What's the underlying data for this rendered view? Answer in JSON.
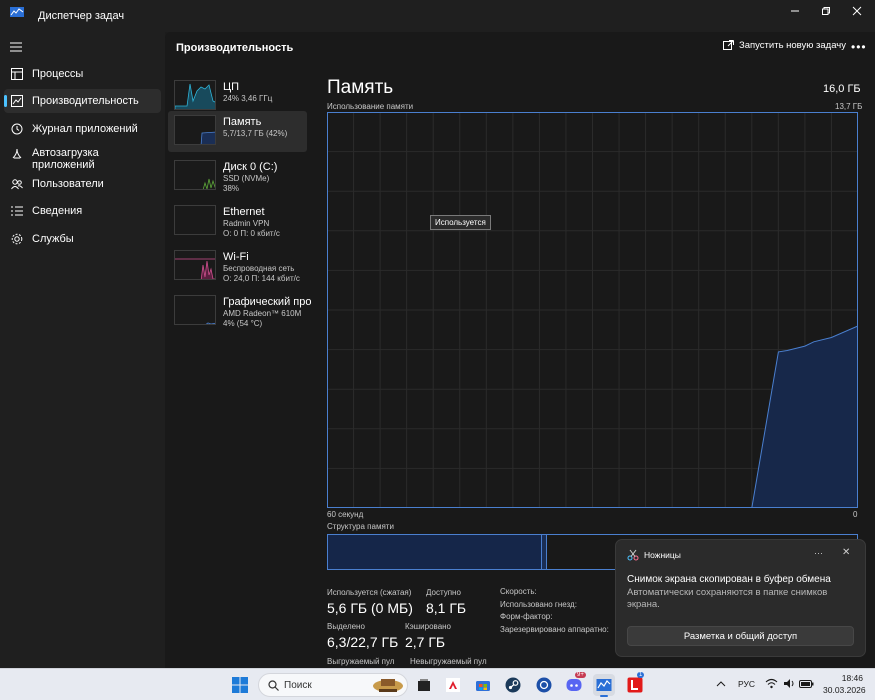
{
  "window": {
    "title": "Диспетчер задач"
  },
  "nav": {
    "items": [
      {
        "label": "Процессы",
        "icon": "grid-icon"
      },
      {
        "label": "Производительность",
        "icon": "performance-icon",
        "active": true
      },
      {
        "label": "Журнал приложений",
        "icon": "history-icon"
      },
      {
        "label": "Автозагрузка приложений",
        "icon": "startup-icon"
      },
      {
        "label": "Пользователи",
        "icon": "users-icon"
      },
      {
        "label": "Сведения",
        "icon": "details-icon"
      },
      {
        "label": "Службы",
        "icon": "services-icon"
      }
    ]
  },
  "header": {
    "title": "Производительность",
    "run_task": "Запустить новую задачу"
  },
  "devices": [
    {
      "name": "ЦП",
      "line1": "24% 3,46 ГГц",
      "line2": "",
      "color": "#2fb4d8"
    },
    {
      "name": "Память",
      "line1": "5,7/13,7 ГБ (42%)",
      "line2": "",
      "color": "#4a7fcf",
      "active": true
    },
    {
      "name": "Диск 0 (C:)",
      "line1": "SSD (NVMe)",
      "line2": "38%",
      "color": "#5ea83a"
    },
    {
      "name": "Ethernet",
      "line1": "Radmin VPN",
      "line2": "О: 0 П: 0 кбит/с",
      "color": "#a54b8f"
    },
    {
      "name": "Wi-Fi",
      "line1": "Беспроводная сеть",
      "line2": "О: 24,0 П: 144 кбит/с",
      "color": "#d0508f"
    },
    {
      "name": "Графический про",
      "line1": "AMD Radeon™ 610M",
      "line2": "4% (54 °C)",
      "color": "#4a7fcf"
    }
  ],
  "memory": {
    "title": "Память",
    "total": "16,0 ГБ",
    "usage_label": "Использование памяти",
    "usage_max": "13,7 ГБ",
    "x_left": "60 секунд",
    "x_right": "0",
    "tooltip": "Используется",
    "structure_label": "Структура памяти",
    "stats": [
      {
        "label": "Используется (сжатая)",
        "value": "5,6 ГБ (0 МБ)"
      },
      {
        "label": "Доступно",
        "value": "8,1 ГБ"
      },
      {
        "label": "Выделено",
        "value": "6,3/22,7 ГБ"
      },
      {
        "label": "Кэшировано",
        "value": "2,7 ГБ"
      },
      {
        "label": "Выгружаемый пул",
        "value": ""
      },
      {
        "label": "Невыгружаемый пул",
        "value": ""
      }
    ],
    "props": [
      {
        "label": "Скорость:"
      },
      {
        "label": "Использовано гнезд:"
      },
      {
        "label": "Форм-фактор:"
      },
      {
        "label": "Зарезервировано аппаратно:"
      }
    ]
  },
  "chart_data": {
    "type": "area",
    "title": "Память",
    "ylabel": "Использование памяти",
    "xlabel": "60 секунд",
    "ylim": [
      0,
      13.7
    ],
    "x": [
      60,
      53,
      52,
      50,
      48,
      45,
      42,
      39,
      36,
      35,
      33,
      32,
      29,
      28,
      25,
      20,
      16,
      12,
      9,
      8,
      6,
      5,
      3,
      0
    ],
    "values": [
      0,
      0,
      0,
      0,
      0,
      0,
      0,
      0,
      0,
      0,
      0,
      0,
      0,
      0,
      0,
      0,
      0,
      0,
      0,
      0,
      0,
      0,
      0,
      0
    ],
    "series": [
      {
        "values": [
          null,
          null,
          null,
          null,
          null,
          null,
          null,
          null,
          null,
          null,
          null,
          null,
          null,
          null,
          null,
          null,
          null,
          0,
          5.4,
          5.45,
          5.6,
          5.75,
          5.9,
          6.3
        ]
      }
    ],
    "grid": true,
    "color": "#4a7fcf"
  },
  "toast": {
    "app": "Ножницы",
    "title": "Снимок экрана скопирован в буфер обмена",
    "body": "Автоматически сохраняются в папке снимков экрана.",
    "button": "Разметка и общий доступ",
    "more": "···"
  },
  "taskbar": {
    "search_placeholder": "Поиск",
    "lang": "РУС",
    "time": "18:46",
    "date": "30.03.2026",
    "badge_discord": "9+",
    "badge_l": "1"
  }
}
